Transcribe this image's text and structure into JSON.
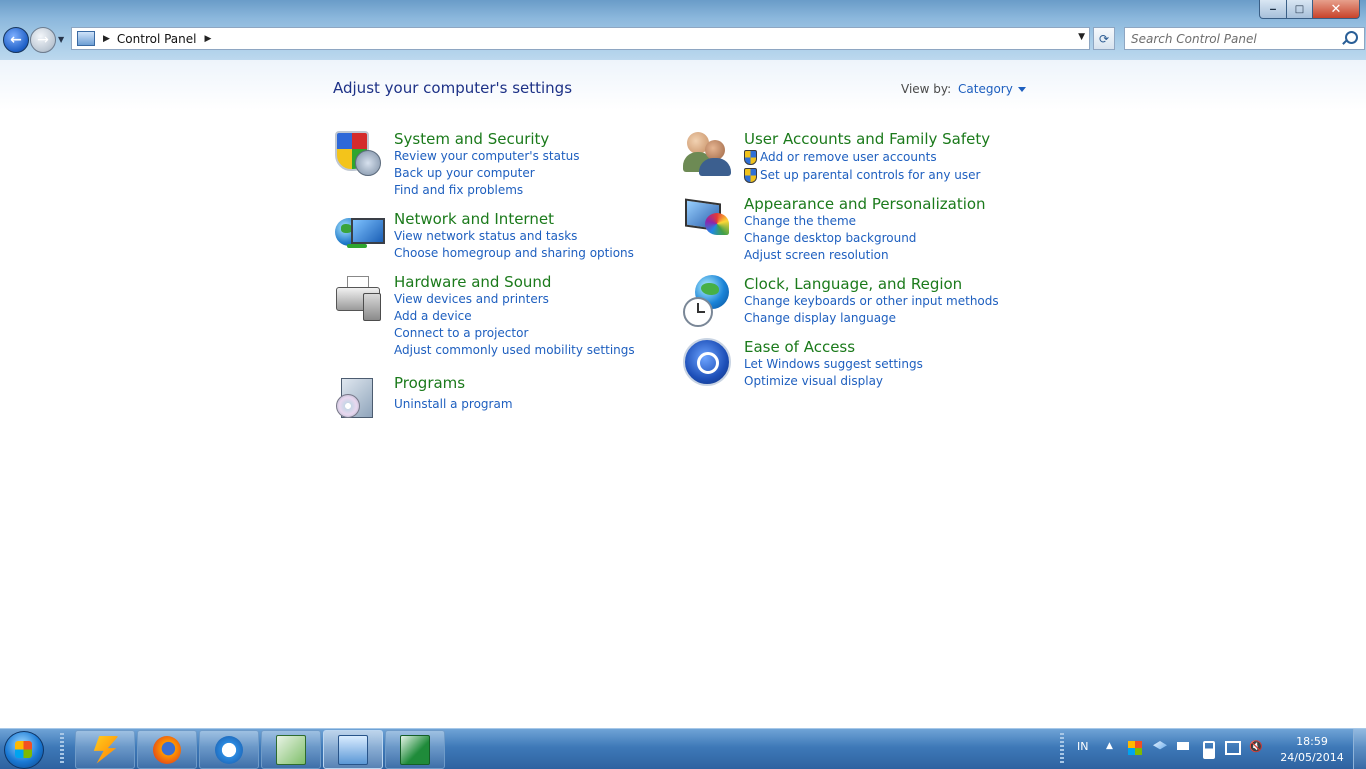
{
  "window": {
    "title_controls": {
      "minimize": "‒",
      "maximize": "□",
      "close": "✕"
    }
  },
  "address": {
    "breadcrumb": [
      "Control Panel"
    ],
    "search_placeholder": "Search Control Panel"
  },
  "header": {
    "title": "Adjust your computer's settings",
    "view_by_label": "View by:",
    "view_by_value": "Category"
  },
  "categories_left": [
    {
      "title": "System and Security",
      "icon": "shield-icon",
      "links": [
        "Review your computer's status",
        "Back up your computer",
        "Find and fix problems"
      ]
    },
    {
      "title": "Network and Internet",
      "icon": "network-globe-icon",
      "links": [
        "View network status and tasks",
        "Choose homegroup and sharing options"
      ]
    },
    {
      "title": "Hardware and Sound",
      "icon": "printer-speaker-icon",
      "links": [
        "View devices and printers",
        "Add a device",
        "Connect to a projector",
        "Adjust commonly used mobility settings"
      ]
    },
    {
      "title": "Programs",
      "icon": "programs-box-icon",
      "links": [
        "Uninstall a program"
      ]
    }
  ],
  "categories_right": [
    {
      "title": "User Accounts and Family Safety",
      "icon": "users-icon",
      "links": [
        "Add or remove user accounts",
        "Set up parental controls for any user"
      ]
    },
    {
      "title": "Appearance and Personalization",
      "icon": "monitor-palette-icon",
      "links": [
        "Change the theme",
        "Change desktop background",
        "Adjust screen resolution"
      ]
    },
    {
      "title": "Clock, Language, and Region",
      "icon": "globe-clock-icon",
      "links": [
        "Change keyboards or other input methods",
        "Change display language"
      ]
    },
    {
      "title": "Ease of Access",
      "icon": "ease-of-access-icon",
      "links": [
        "Let Windows suggest settings",
        "Optimize visual display"
      ]
    }
  ],
  "taskbar": {
    "apps": [
      "winamp-icon",
      "firefox-icon",
      "internet-explorer-icon",
      "lab-app-icon",
      "control-panel-icon",
      "excel-icon"
    ],
    "language": "IN",
    "time": "18:59",
    "date": "24/05/2014"
  }
}
